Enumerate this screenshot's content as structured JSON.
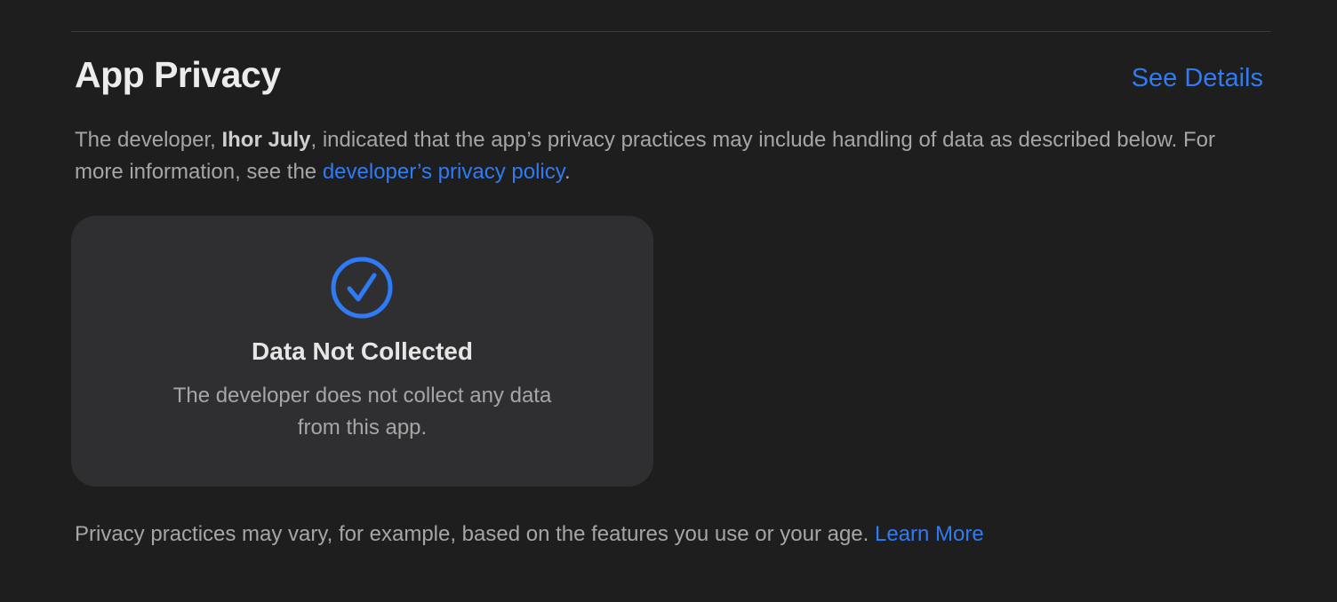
{
  "section": {
    "title": "App Privacy",
    "see_details_label": "See Details"
  },
  "description": {
    "prefix": "The developer, ",
    "developer_name": "Ihor July",
    "middle": ", indicated that the app’s privacy practices may include handling of data as described below. For more information, see the ",
    "policy_link": "developer’s privacy policy",
    "suffix": "."
  },
  "card": {
    "icon": "checkmark-circle-icon",
    "title": "Data Not Collected",
    "text": "The developer does not collect any data from this app."
  },
  "footer": {
    "text": "Privacy practices may vary, for example, based on the features you use or your age. ",
    "learn_more_label": "Learn More"
  },
  "colors": {
    "background": "#1e1e1e",
    "card": "#2f2f31",
    "accent": "#2f7bf5",
    "title": "#ececec",
    "body_text": "#a6a6a6"
  }
}
